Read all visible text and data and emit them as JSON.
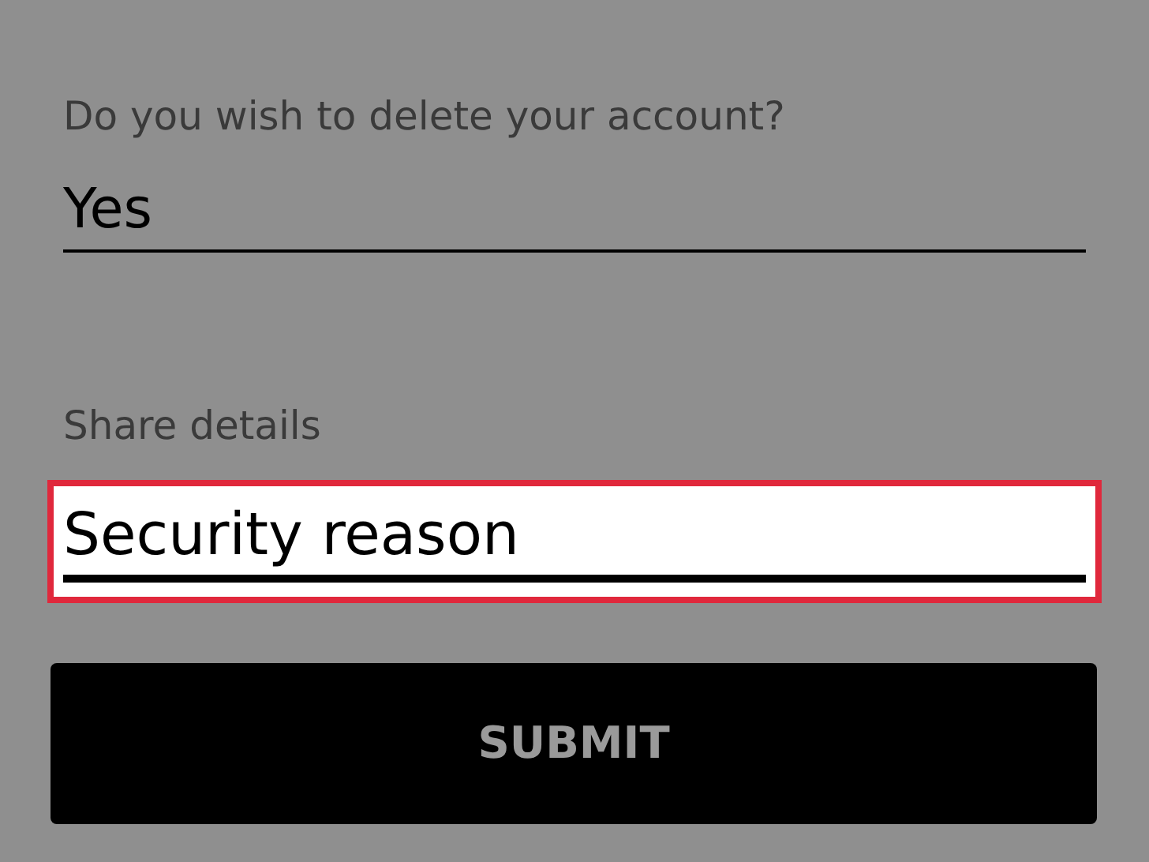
{
  "fields": [
    {
      "label": "Do you wish to delete your account?",
      "value": "Yes",
      "highlighted": false
    },
    {
      "label": "Share details",
      "value": "Security reason",
      "highlighted": true
    }
  ],
  "submit_button": {
    "label": "SUBMIT",
    "disabled": true
  }
}
